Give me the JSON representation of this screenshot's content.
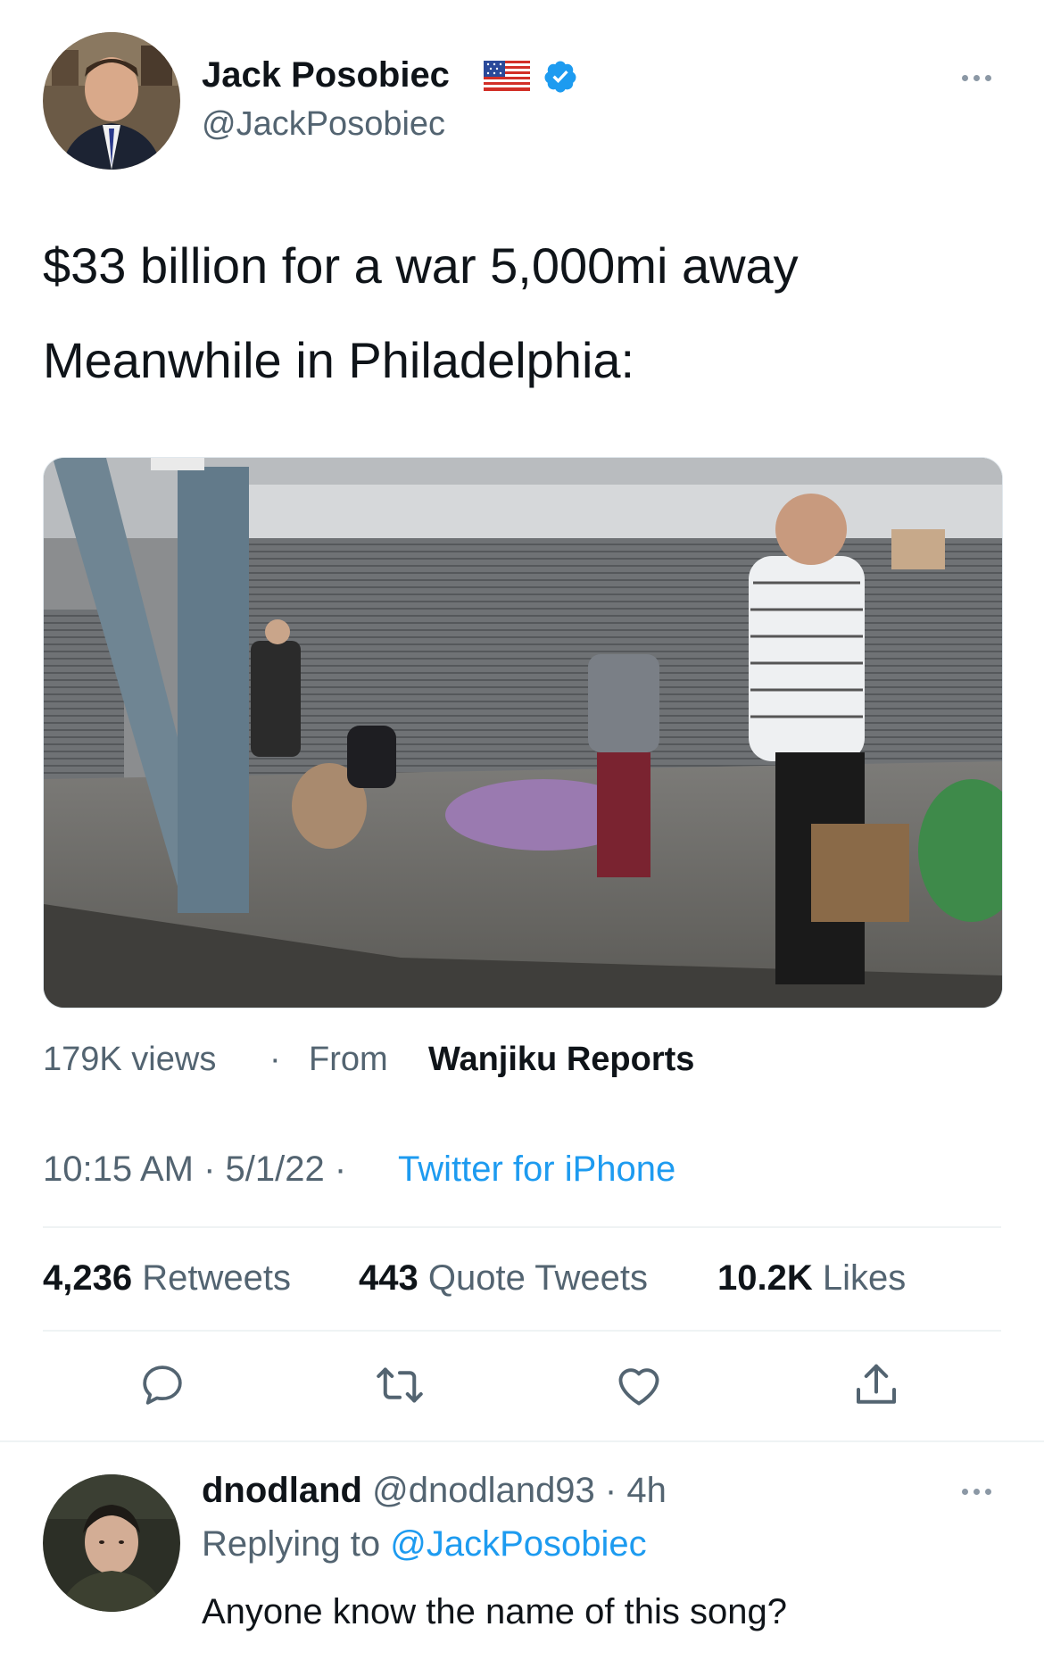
{
  "tweet": {
    "author_name": "Jack Posobiec",
    "author_handle": "@JackPosobiec",
    "text_line1": "$33 billion for a war 5,000mi away",
    "text_line2": "Meanwhile in Philadelphia:",
    "media": {
      "views": "179K views",
      "separator": "·",
      "from_label": "From",
      "source": "Wanjiku Reports"
    },
    "timestamp": "10:15 AM · 5/1/22 ·",
    "client": "Twitter for iPhone",
    "stats": {
      "retweets_count": "4,236",
      "retweets_label": "Retweets",
      "quotes_count": "443",
      "quotes_label": "Quote Tweets",
      "likes_count": "10.2K",
      "likes_label": "Likes"
    },
    "actions": [
      "reply-icon",
      "retweet-icon",
      "like-icon",
      "share-icon"
    ]
  },
  "reply": {
    "author_name": "dnodland",
    "author_handle": "@dnodland93 · 4h",
    "replying_label": "Replying to",
    "replying_to": "@JackPosobiec",
    "text": "Anyone know the name of this song?"
  },
  "colors": {
    "accent": "#1d9bf0",
    "muted": "#536471",
    "text": "#0f1419",
    "divider": "#eff3f4"
  }
}
